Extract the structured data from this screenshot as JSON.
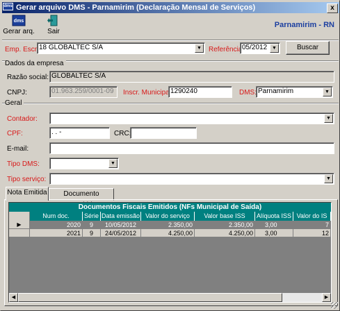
{
  "window": {
    "title": "Gerar arquivo DMS - Parnamirim (Declaração Mensal de Serviços)",
    "icon_text": "dms",
    "close_glyph": "x"
  },
  "toolbar": {
    "generate_label": "Gerar arq.",
    "exit_label": "Sair",
    "location": "Parnamirim - RN"
  },
  "top_row": {
    "emp_label": "Emp. Escr.:",
    "emp_value": "18  GLOBALTEC S/A",
    "ref_label": "Referência:",
    "ref_value": "05/2012",
    "search_label": "Buscar"
  },
  "empresa": {
    "section_label": "Dados da empresa",
    "razao_label": "Razão social:",
    "razao_value": "GLOBALTEC S/A",
    "cnpj_label": "CNPJ:",
    "cnpj_value": "01.963.259/0001-09",
    "inscr_label": "Inscr. Municipal:",
    "inscr_value": "1290240",
    "dms_label": "DMS:",
    "dms_value": "Parnamirim"
  },
  "geral": {
    "section_label": "Geral",
    "contador_label": "Contador:",
    "contador_value": "",
    "cpf_label": "CPF:",
    "cpf_value": "   .   .   -  ",
    "crc_label": "CRC:",
    "crc_value": "",
    "email_label": "E-mail:",
    "email_value": "",
    "tipo_dms_label": "Tipo DMS:",
    "tipo_dms_value": "",
    "tipo_servico_label": "Tipo serviço:",
    "tipo_servico_value": ""
  },
  "tabs": [
    {
      "label": "Nota Emitida"
    },
    {
      "label": "Documento Recebido"
    }
  ],
  "grid": {
    "title": "Documentos Fiscais Emitidos (NFs Municipal de Saída)",
    "columns": [
      "Num doc.",
      "Série",
      "Data emissão",
      "Valor do serviço",
      "Valor base ISS",
      "Alíquota ISS",
      "Valor do IS"
    ],
    "rows": [
      {
        "num": "2020",
        "serie": "9",
        "data": "10/05/2012",
        "valor": "2.350,00",
        "base": "2.350,00",
        "aliquota": "3,00",
        "iss": "7"
      },
      {
        "num": "2021",
        "serie": "9",
        "data": "24/05/2012",
        "valor": "4.250,00",
        "base": "4.250,00",
        "aliquota": "3,00",
        "iss": "12"
      }
    ],
    "row_pointer": "▶"
  },
  "colors": {
    "title_bar": "#0a246a",
    "grid_header": "#008080",
    "required_label": "#d81818",
    "location_text": "#1c3fa0"
  }
}
